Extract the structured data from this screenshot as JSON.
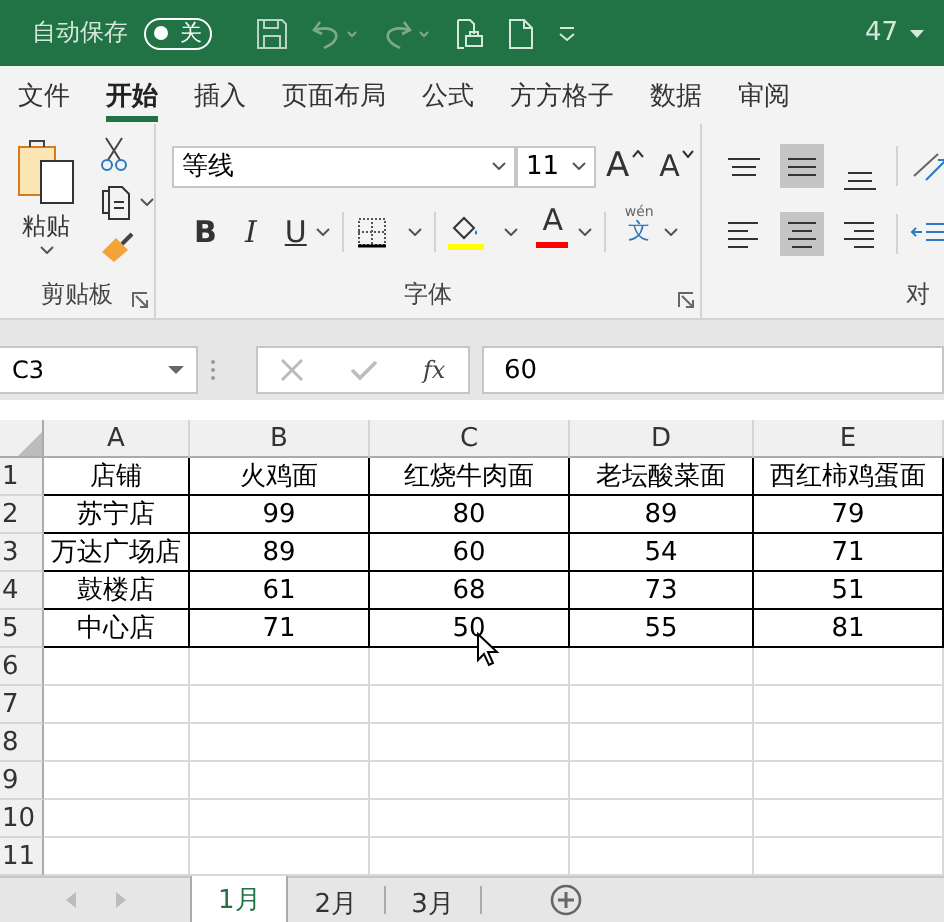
{
  "title_bar": {
    "autosave_label": "自动保存",
    "autosave": {
      "label": "关",
      "on": false
    },
    "count": "47"
  },
  "tabs": [
    {
      "label": "文件",
      "selected": false
    },
    {
      "label": "开始",
      "selected": true
    },
    {
      "label": "插入",
      "selected": false
    },
    {
      "label": "页面布局",
      "selected": false
    },
    {
      "label": "公式",
      "selected": false
    },
    {
      "label": "方方格子",
      "selected": false
    },
    {
      "label": "数据",
      "selected": false
    },
    {
      "label": "审阅",
      "selected": false
    }
  ],
  "ribbon": {
    "clipboard": {
      "paste_label": "粘贴",
      "group_label": "剪贴板"
    },
    "font": {
      "font_name": "等线",
      "font_size": "11",
      "grow": "A",
      "shrink": "A",
      "bold": "B",
      "italic": "I",
      "underline": "U",
      "font_color_letter": "A",
      "phonetic_top": "wén",
      "phonetic_bottom": "文",
      "group_label": "字体"
    },
    "alignment": {
      "buttons": [
        {
          "kind": "top",
          "selected": false
        },
        {
          "kind": "middle",
          "selected": true
        },
        {
          "kind": "bottom",
          "selected": false
        },
        {
          "kind": "left",
          "selected": false
        },
        {
          "kind": "center",
          "selected": true
        },
        {
          "kind": "right",
          "selected": false
        }
      ],
      "group_label": "对"
    }
  },
  "formula_bar": {
    "name_box": "C3",
    "function_label": "fx",
    "value": "60"
  },
  "sheet": {
    "columns": [
      "A",
      "B",
      "C",
      "D",
      "E"
    ],
    "row_numbers": [
      "1",
      "2",
      "3",
      "4",
      "5",
      "6",
      "7",
      "8",
      "9",
      "10",
      "11"
    ],
    "rows": [
      [
        "店铺",
        "火鸡面",
        "红烧牛肉面",
        "老坛酸菜面",
        "西红柿鸡蛋面"
      ],
      [
        "苏宁店",
        "99",
        "80",
        "89",
        "79"
      ],
      [
        "万达广场店",
        "89",
        "60",
        "54",
        "71"
      ],
      [
        "鼓楼店",
        "61",
        "68",
        "73",
        "51"
      ],
      [
        "中心店",
        "71",
        "50",
        "55",
        "81"
      ]
    ]
  },
  "sheet_tabs": [
    {
      "label": "1月",
      "selected": true
    },
    {
      "label": "2月",
      "selected": false
    },
    {
      "label": "3月",
      "selected": false
    }
  ]
}
